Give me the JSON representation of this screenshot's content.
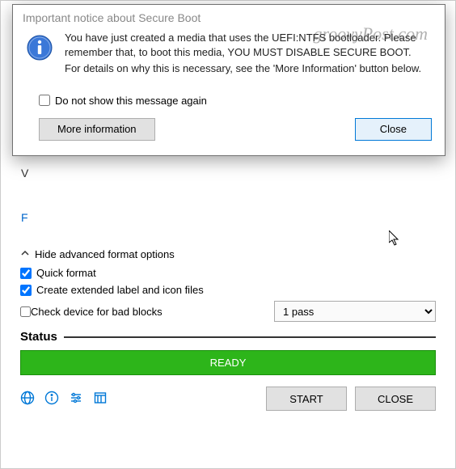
{
  "watermark": "groovyPost.com",
  "modal": {
    "title": "Important notice about Secure Boot",
    "body_line1": "You have just created a media that uses the UEFI:NTFS bootloader. Please remember that, to boot this media, YOU MUST DISABLE SECURE BOOT.",
    "body_line2": "For details on why this is necessary, see the 'More Information' button below.",
    "checkbox_label": "Do not show this message again",
    "more_info_btn": "More information",
    "close_btn": "Close"
  },
  "main": {
    "hide_advanced": "Hide advanced format options",
    "quick_format": "Quick format",
    "create_extended": "Create extended label and icon files",
    "check_bad_blocks": "Check device for bad blocks",
    "pass_select": "1 pass",
    "status_label": "Status",
    "status_value": "READY",
    "start_btn": "START",
    "close_btn": "CLOSE"
  }
}
